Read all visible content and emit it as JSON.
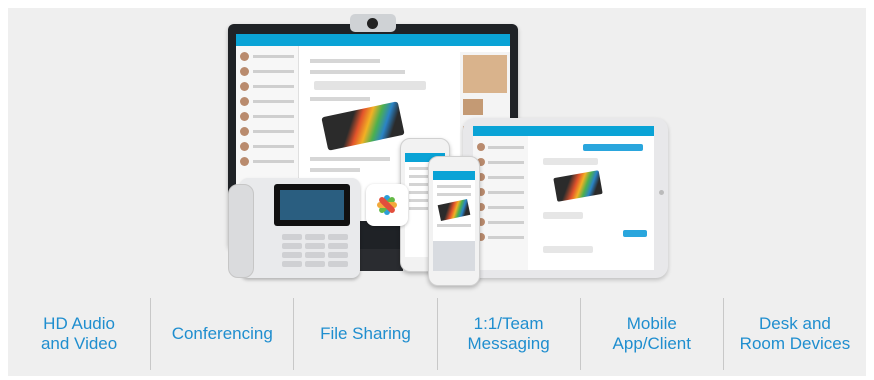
{
  "features": [
    {
      "label": "HD Audio\nand Video"
    },
    {
      "label": "Conferencing"
    },
    {
      "label": "File Sharing"
    },
    {
      "label": "1:1/Team\nMessaging"
    },
    {
      "label": "Mobile\nApp/Client"
    },
    {
      "label": "Desk and\nRoom Devices"
    }
  ],
  "colors": {
    "feature_text": "#1f8ecf",
    "panel_bg": "#efefef",
    "accent": "#0aa3d6"
  }
}
